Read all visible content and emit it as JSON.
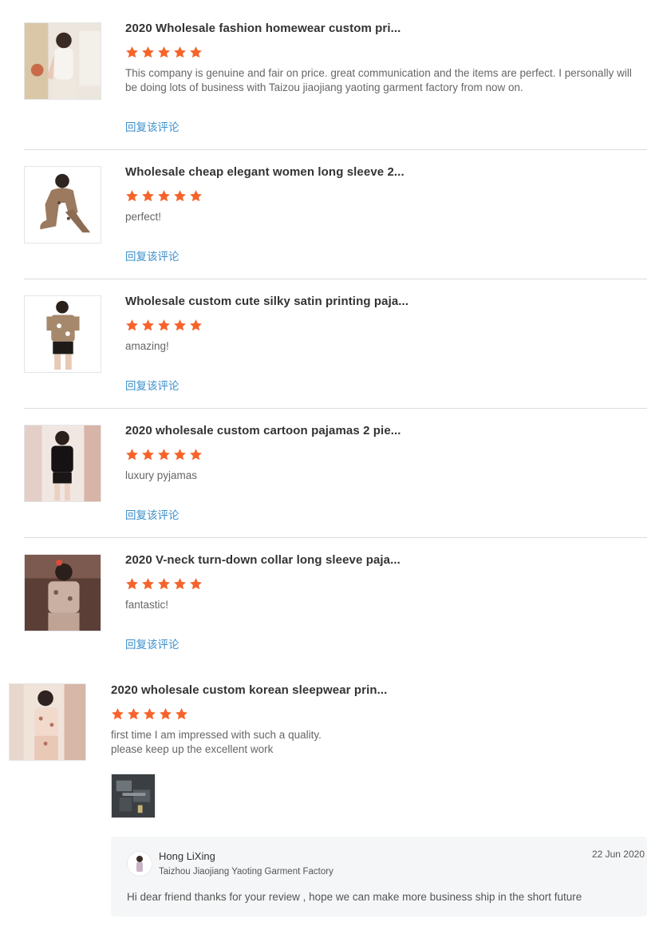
{
  "reviews": [
    {
      "title": "2020 Wholesale fashion homewear custom pri...",
      "rating": 5,
      "comment": "This company is genuine and fair on price. great communication and the items are perfect. I personally will be doing lots of business with Taizou jiaojiang yaoting garment factory from now on.",
      "reply_label": "回复该评论"
    },
    {
      "title": "Wholesale cheap elegant women long sleeve 2...",
      "rating": 5,
      "comment": "perfect!",
      "reply_label": "回复该评论"
    },
    {
      "title": "Wholesale custom cute silky satin printing paja...",
      "rating": 5,
      "comment": "amazing!",
      "reply_label": "回复该评论"
    },
    {
      "title": "2020 wholesale custom cartoon pajamas 2 pie...",
      "rating": 5,
      "comment": "luxury pyjamas",
      "reply_label": "回复该评论"
    },
    {
      "title": "2020 V-neck turn-down collar long sleeve paja...",
      "rating": 5,
      "comment": "fantastic!",
      "reply_label": "回复该评论"
    },
    {
      "title": "2020 wholesale custom korean sleepwear prin...",
      "rating": 5,
      "comment_line1": "first time I am impressed with such a quality.",
      "comment_line2": "please keep up the excellent work"
    }
  ],
  "seller_reply": {
    "name": "Hong LiXing",
    "company": "Taizhou Jiaojiang Yaoting Garment Factory",
    "date": "22 Jun 2020",
    "text": "Hi dear friend  thanks for your review , hope we can make more business ship in the short future"
  },
  "colors": {
    "star": "#f7632a",
    "link": "#3b8fcb",
    "divider": "#dcdcdc"
  }
}
